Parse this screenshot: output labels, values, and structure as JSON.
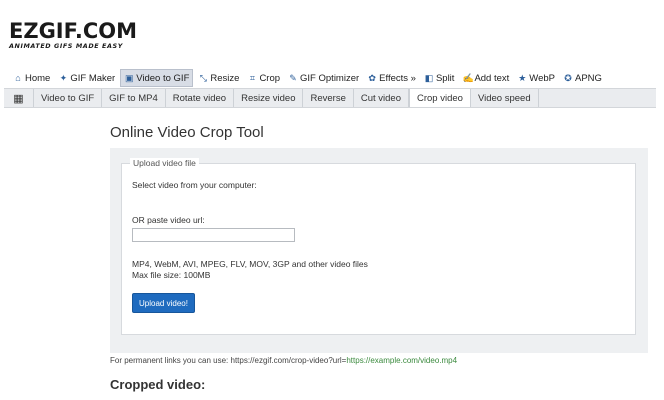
{
  "logo": {
    "main": "EZGIF.COM",
    "tagline": "ANIMATED GIFS MADE EASY"
  },
  "main_nav": [
    {
      "label": "Home",
      "icon": "home-icon",
      "glyph": "⌂",
      "active": false
    },
    {
      "label": "GIF Maker",
      "icon": "gif-maker-icon",
      "glyph": "✦",
      "active": false
    },
    {
      "label": "Video to GIF",
      "icon": "video-icon",
      "glyph": "▣",
      "active": true
    },
    {
      "label": "Resize",
      "icon": "resize-icon",
      "glyph": "⤡",
      "active": false
    },
    {
      "label": "Crop",
      "icon": "crop-icon",
      "glyph": "⌗",
      "active": false
    },
    {
      "label": "GIF Optimizer",
      "icon": "optimizer-icon",
      "glyph": "✎",
      "active": false
    },
    {
      "label": "Effects »",
      "icon": "effects-icon",
      "glyph": "✿",
      "active": false
    },
    {
      "label": "Split",
      "icon": "split-icon",
      "glyph": "◧",
      "active": false
    },
    {
      "label": "Add text",
      "icon": "add-text-icon",
      "glyph": "✍",
      "active": false
    },
    {
      "label": "WebP",
      "icon": "webp-icon",
      "glyph": "★",
      "active": false
    },
    {
      "label": "APNG",
      "icon": "apng-icon",
      "glyph": "✪",
      "active": false
    }
  ],
  "sub_nav": {
    "icon": "film-icon",
    "items": [
      {
        "label": "Video to GIF",
        "active": false
      },
      {
        "label": "GIF to MP4",
        "active": false
      },
      {
        "label": "Rotate video",
        "active": false
      },
      {
        "label": "Resize video",
        "active": false
      },
      {
        "label": "Reverse",
        "active": false
      },
      {
        "label": "Cut video",
        "active": false
      },
      {
        "label": "Crop video",
        "active": true
      },
      {
        "label": "Video speed",
        "active": false
      }
    ]
  },
  "page": {
    "title": "Online Video Crop Tool",
    "upload": {
      "legend": "Upload video file",
      "select_label": "Select video from your computer:",
      "url_label": "OR paste video url:",
      "url_value": "",
      "formats": "MP4, WebM, AVI, MPEG, FLV, MOV, 3GP and other video files",
      "max_size": "Max file size: 100MB",
      "button": "Upload video!"
    },
    "permanent_prefix": "For permanent links you can use: https://ezgif.com/crop-video?url=",
    "permanent_link": "https://example.com/video.mp4",
    "cropped_heading": "Cropped video:"
  },
  "colors": {
    "accent": "#1f6bbf",
    "link_green": "#3b8a3e",
    "panel_bg": "#eef0f2"
  }
}
